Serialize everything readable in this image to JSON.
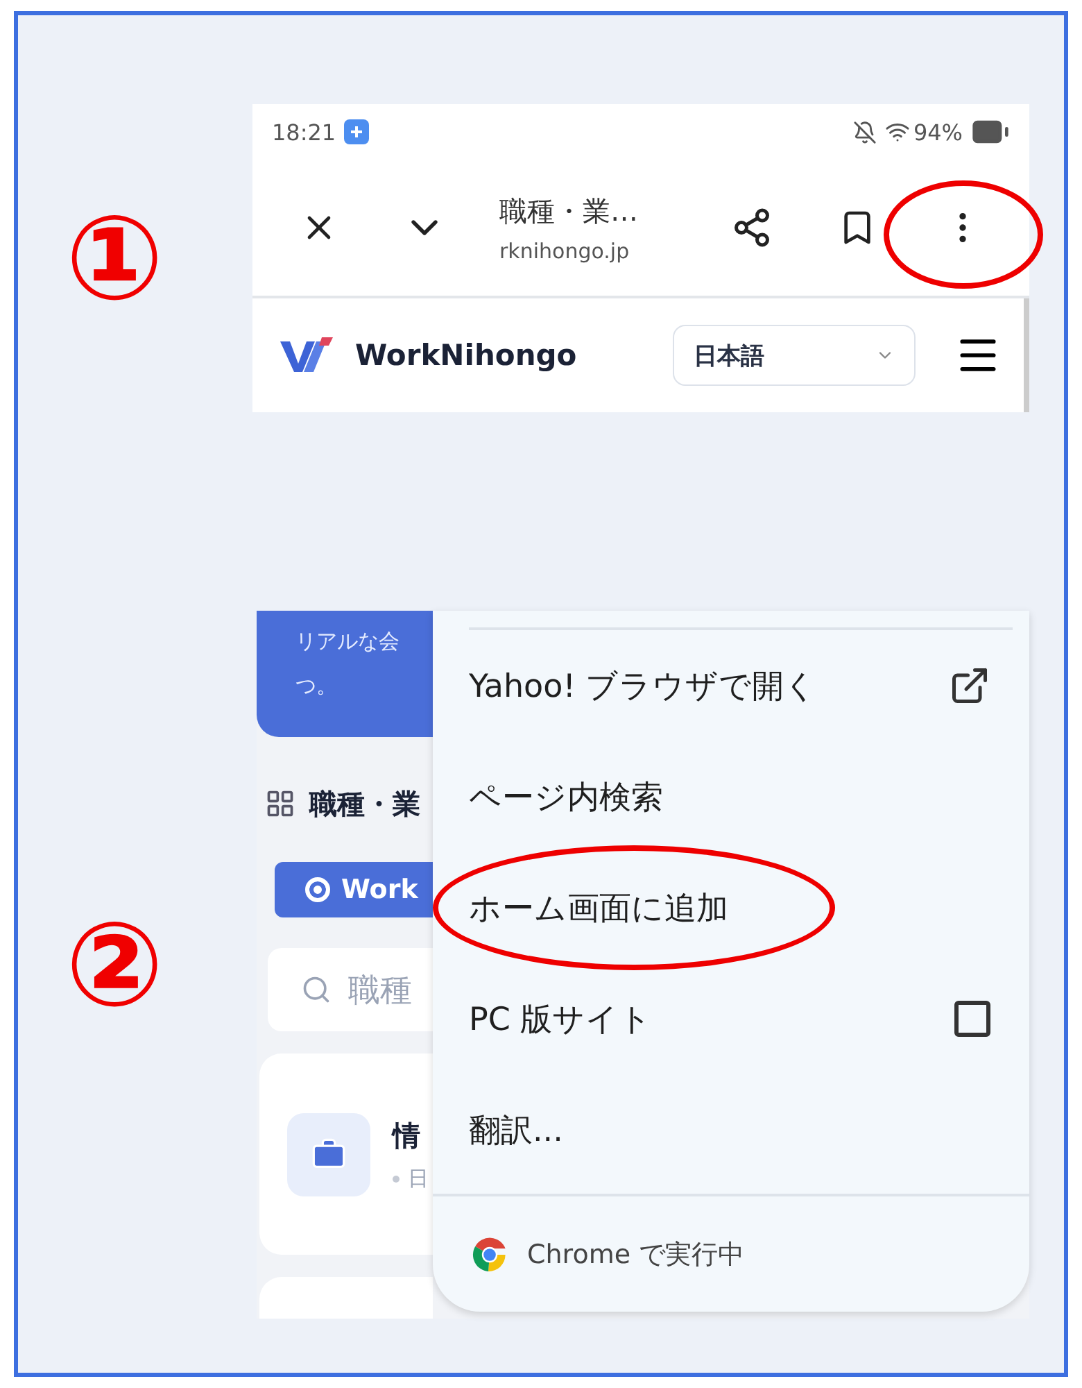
{
  "markers": [
    {
      "label": "①"
    },
    {
      "label": "②"
    }
  ],
  "screen1": {
    "status_bar": {
      "time": "18:21",
      "battery": "94%"
    },
    "toolbar": {
      "title": "職種・業…",
      "url": "rknihongo.jp"
    },
    "site_header": {
      "brand": "WorkNihongo",
      "language": "日本語"
    }
  },
  "screen2": {
    "page": {
      "banner_lines": [
        "リアルな会",
        "つ。"
      ],
      "section_title": "職種・業",
      "filter_chip": {
        "label": "Work",
        "selected": true
      },
      "search": {
        "placeholder": "職種"
      },
      "card": {
        "title": "情",
        "meta": "日"
      }
    },
    "menu": {
      "items": [
        {
          "label": "Yahoo! ブラウザで開く",
          "kind": "external"
        },
        {
          "label": "ページ内検索",
          "kind": "plain"
        },
        {
          "label": "ホーム画面に追加",
          "kind": "plain",
          "highlighted": true
        },
        {
          "label": "PC 版サイト",
          "kind": "checkbox",
          "checked": false
        },
        {
          "label": "翻訳...",
          "kind": "plain"
        }
      ],
      "footer": "Chrome で実行中"
    }
  }
}
